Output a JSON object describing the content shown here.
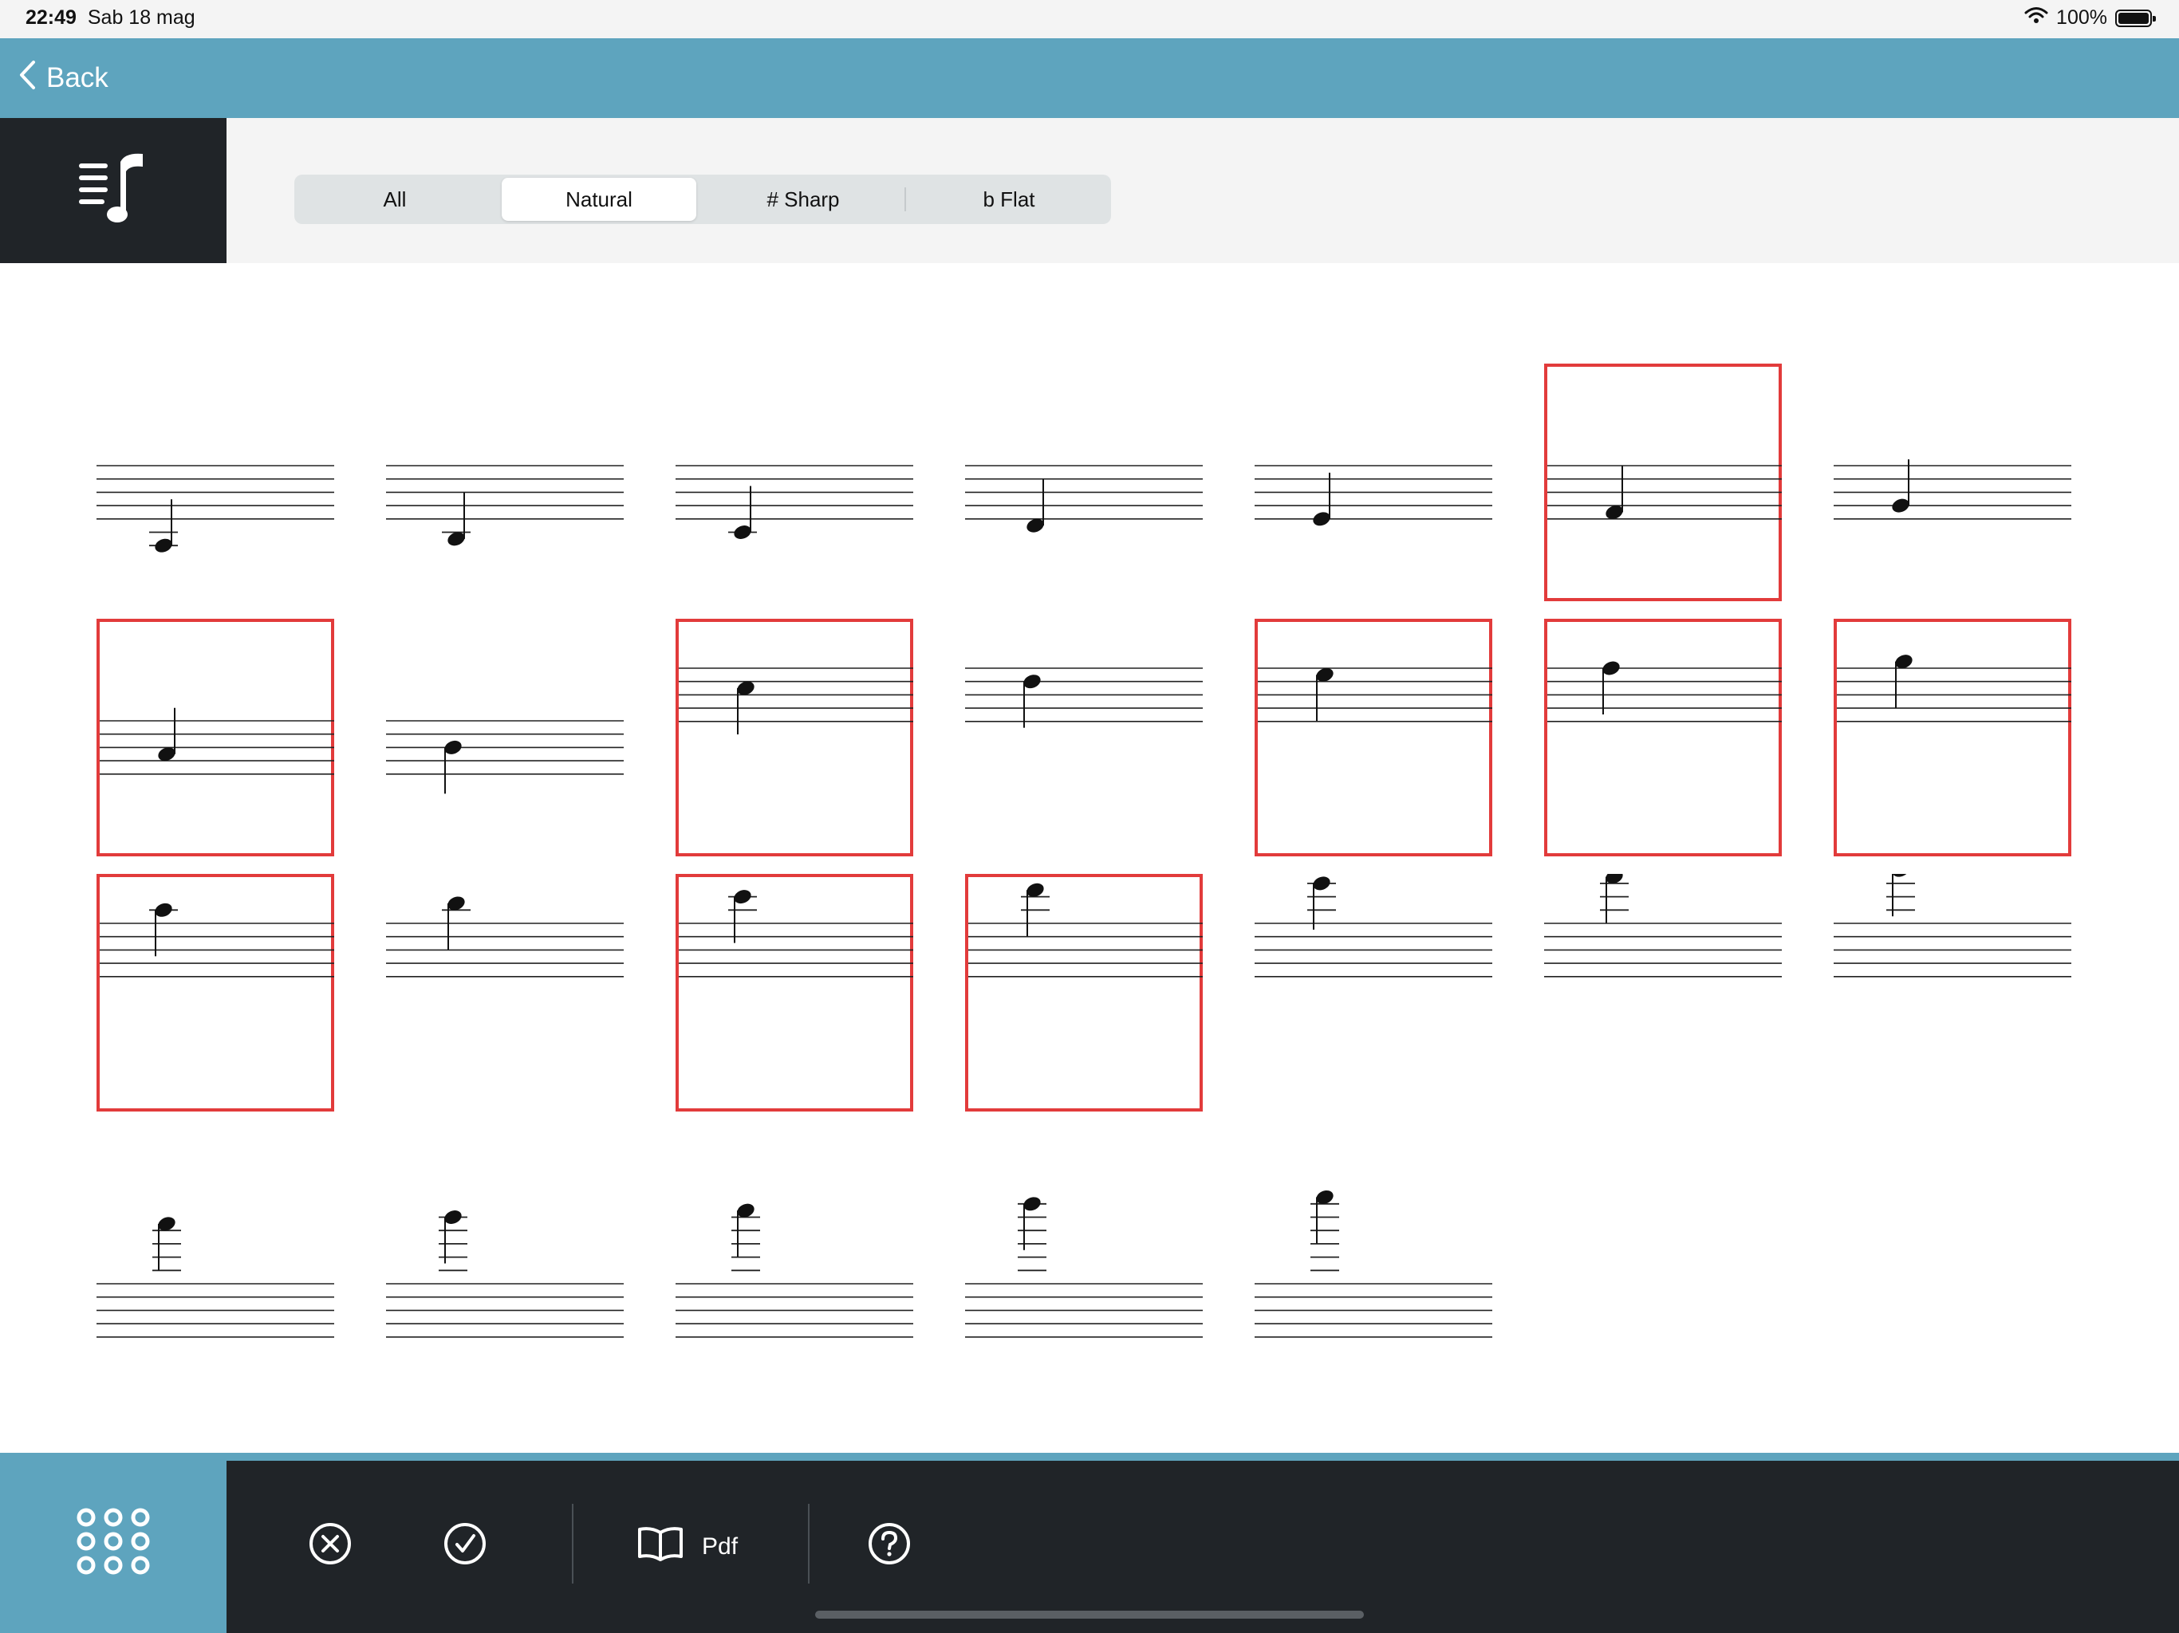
{
  "status_bar": {
    "time": "22:49",
    "date": "Sab 18 mag",
    "battery": "100%"
  },
  "nav": {
    "back_label": "Back"
  },
  "filter": {
    "options": [
      "All",
      "Natural",
      "# Sharp",
      "b Flat"
    ],
    "selected": "Natural"
  },
  "notes": {
    "filter_mode": "Natural",
    "grid_columns": 7,
    "count": 26,
    "selected_indices": [
      5,
      7,
      9,
      11,
      12,
      13,
      14,
      16,
      17
    ]
  },
  "bottom_toolbar": {
    "pdf_label": "Pdf"
  },
  "icons": {
    "back": "chevron-left-icon",
    "logo": "music-list-icon",
    "keypad": "keypad-icon",
    "clear": "circle-x-icon",
    "confirm": "circle-check-icon",
    "pdf": "book-icon",
    "help": "question-circle-icon"
  },
  "colors": {
    "accent": "#5ea4be",
    "dark": "#202428",
    "selection": "#e23b3b",
    "toolbar_bg": "#f4f4f4"
  }
}
